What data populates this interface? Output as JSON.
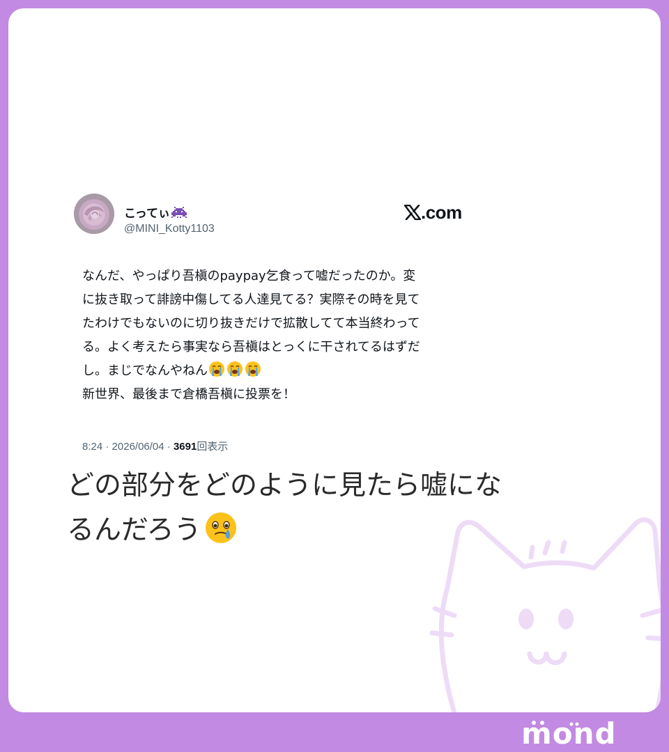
{
  "tweet": {
    "display_name": "こってぃ",
    "name_emoji": "purple-invader-emoji",
    "handle": "@MINI_Kotty1103",
    "source": "𝕏.com",
    "source_text": ".com",
    "body_lines": [
      "なんだ、やっぱり吾槇のpaypay乞食って嘘だったのか。変",
      "に抜き取って誹謗中傷してる人達見てる？実際その時を見て",
      "たわけでもないのに切り抜きだけで拡散してて本当終わって",
      "る。よく考えたら事実なら吾槇はとっくに干されてるはずだ",
      "し。まじでなんやねん",
      "新世界、最後まで倉橋吾槇に投票を！"
    ],
    "crying_emojis": [
      "😭",
      "😭",
      "😭"
    ],
    "time": "8:24",
    "date": "2026/06/04",
    "views_count": "3691",
    "views_label": "回表示"
  },
  "comment": {
    "lines": [
      "どの部分をどのように見たら嘘にな",
      "るんだろう"
    ],
    "emoji": "face-holding-back-tears"
  },
  "brand": {
    "logo": "mond"
  },
  "colors": {
    "frame": "#c28ae2",
    "card": "#ffffff",
    "tweet_text": "#0f1419",
    "meta_text": "#536471",
    "cat_watermark": "#eedcf7"
  }
}
